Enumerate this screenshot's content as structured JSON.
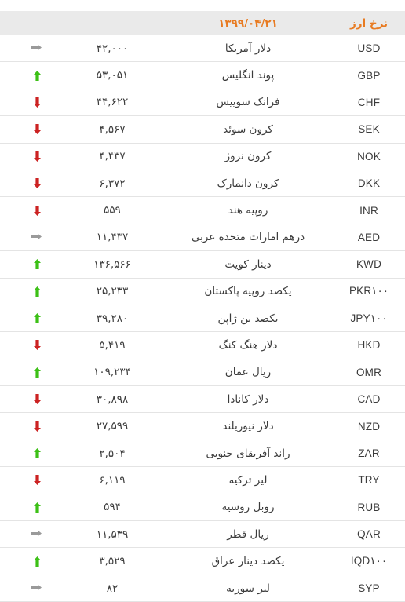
{
  "header": {
    "title": "نرخ ارز",
    "date": "۱۳۹۹/۰۴/۲۱",
    "blank_value": "",
    "blank_arrow": "",
    "blank_chart": "",
    "blank_rss": ""
  },
  "colors": {
    "header_bg": "#eaeaea",
    "header_text": "#e87b22",
    "row_border": "#e4e4e4",
    "up": "#3cc016",
    "down": "#cc2222",
    "flat": "#9a9a9a",
    "rss_orange": "#ee7f16",
    "chart_blue": "#3b6fa8",
    "body_text": "#3b3b3b"
  },
  "icons": {
    "rss": "rss-icon",
    "chart": "chart-icon",
    "arrow_up": "arrow-up-icon",
    "arrow_down": "arrow-down-icon",
    "arrow_flat": "arrow-right-icon"
  },
  "rows": [
    {
      "symbol": "USD",
      "name": "دلار آمریکا",
      "value": "۴۲,۰۰۰",
      "trend": "flat"
    },
    {
      "symbol": "GBP",
      "name": "پوند انگلیس",
      "value": "۵۳,۰۵۱",
      "trend": "up"
    },
    {
      "symbol": "CHF",
      "name": "فرانک سوییس",
      "value": "۴۴,۶۲۲",
      "trend": "down"
    },
    {
      "symbol": "SEK",
      "name": "کرون سوئد",
      "value": "۴,۵۶۷",
      "trend": "down"
    },
    {
      "symbol": "NOK",
      "name": "کرون نروژ",
      "value": "۴,۴۳۷",
      "trend": "down"
    },
    {
      "symbol": "DKK",
      "name": "کرون دانمارک",
      "value": "۶,۳۷۲",
      "trend": "down"
    },
    {
      "symbol": "INR",
      "name": "روپیه هند",
      "value": "۵۵۹",
      "trend": "down"
    },
    {
      "symbol": "AED",
      "name": "درهم امارات متحده عربی",
      "value": "۱۱,۴۳۷",
      "trend": "flat"
    },
    {
      "symbol": "KWD",
      "name": "دینار کویت",
      "value": "۱۳۶,۵۶۶",
      "trend": "up"
    },
    {
      "symbol": "PKR۱۰۰",
      "name": "یکصد روپیه پاکستان",
      "value": "۲۵,۲۳۳",
      "trend": "up"
    },
    {
      "symbol": "JPY۱۰۰",
      "name": "یکصد ین ژاپن",
      "value": "۳۹,۲۸۰",
      "trend": "up"
    },
    {
      "symbol": "HKD",
      "name": "دلار هنگ کنگ",
      "value": "۵,۴۱۹",
      "trend": "down"
    },
    {
      "symbol": "OMR",
      "name": "ریال عمان",
      "value": "۱۰۹,۲۳۴",
      "trend": "up"
    },
    {
      "symbol": "CAD",
      "name": "دلار کانادا",
      "value": "۳۰,۸۹۸",
      "trend": "down"
    },
    {
      "symbol": "NZD",
      "name": "دلار نیوزیلند",
      "value": "۲۷,۵۹۹",
      "trend": "down"
    },
    {
      "symbol": "ZAR",
      "name": "راند آفریقای جنوبی",
      "value": "۲,۵۰۴",
      "trend": "up"
    },
    {
      "symbol": "TRY",
      "name": "لیر ترکیه",
      "value": "۶,۱۱۹",
      "trend": "down"
    },
    {
      "symbol": "RUB",
      "name": "روبل روسیه",
      "value": "۵۹۴",
      "trend": "up"
    },
    {
      "symbol": "QAR",
      "name": "ریال قطر",
      "value": "۱۱,۵۳۹",
      "trend": "flat"
    },
    {
      "symbol": "IQD۱۰۰",
      "name": "یکصد دینار عراق",
      "value": "۳,۵۲۹",
      "trend": "up"
    },
    {
      "symbol": "SYP",
      "name": "لیر سوریه",
      "value": "۸۲",
      "trend": "flat"
    }
  ]
}
